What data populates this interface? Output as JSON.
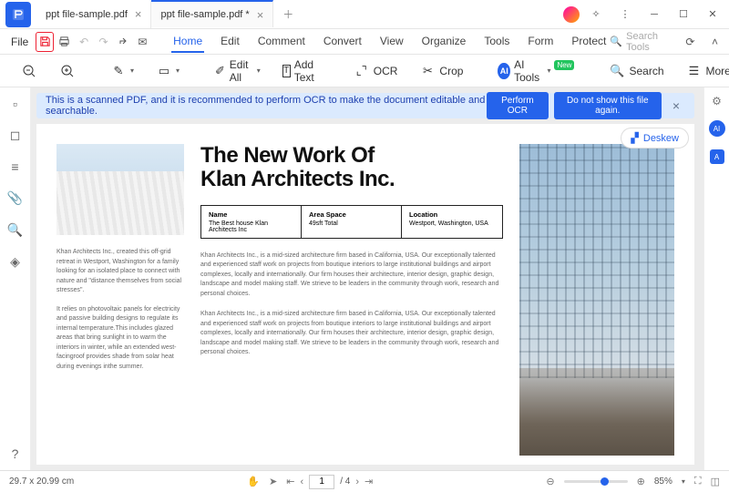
{
  "tabs": {
    "t0": "ppt file-sample.pdf",
    "t1": "ppt file-sample.pdf *"
  },
  "menu": {
    "file": "File"
  },
  "menuTabs": {
    "home": "Home",
    "edit": "Edit",
    "comment": "Comment",
    "convert": "Convert",
    "view": "View",
    "organize": "Organize",
    "tools": "Tools",
    "form": "Form",
    "protect": "Protect"
  },
  "searchTools": "Search Tools",
  "toolbar": {
    "editAll": "Edit All",
    "addText": "Add Text",
    "ocr": "OCR",
    "crop": "Crop",
    "aiTools": "AI Tools",
    "newBadge": "New",
    "search": "Search",
    "more": "More"
  },
  "banner": {
    "message": "This is a scanned PDF, and it is recommended to perform OCR to make the document editable and searchable.",
    "performOcr": "Perform OCR",
    "doNotShow": "Do not show this file again."
  },
  "deskew": "Deskew",
  "doc": {
    "headline1": "The New Work Of",
    "headline2": "Klan Architects Inc.",
    "col1Label": "Name",
    "col1Text": "The Best house Klan Architects Inc",
    "col2Label": "Area Space",
    "col2Text": "49sft Total",
    "col3Label": "Location",
    "col3Text": "Westport, Washington, USA",
    "leftP1": "Khan Architects Inc., created this off-grid retreat in Westport, Washington for a family looking for an isolated place to connect with nature and \"distance themselves from social stresses\".",
    "leftP2": "It relies on photovoltaic panels for electricity and passive building designs to regulate its internal temperature.This includes glazed areas that bring sunlight in to warm the interiors in winter, while an extended west-facingroof provides shade from solar heat during evenings inthe summer.",
    "bodyP": "Khan Architects Inc., is a mid-sized architecture firm based in California, USA. Our exceptionally talented and experienced staff work on projects from boutique interiors to large institutional buildings and airport complexes, locally and internationally. Our firm houses their architecture, interior design, graphic design, landscape and model making staff. We strieve to be leaders in the community through work, research and personal choices."
  },
  "status": {
    "dims": "29.7 x 20.99 cm",
    "page": "1",
    "pageTotal": "/ 4",
    "zoom": "85%"
  }
}
